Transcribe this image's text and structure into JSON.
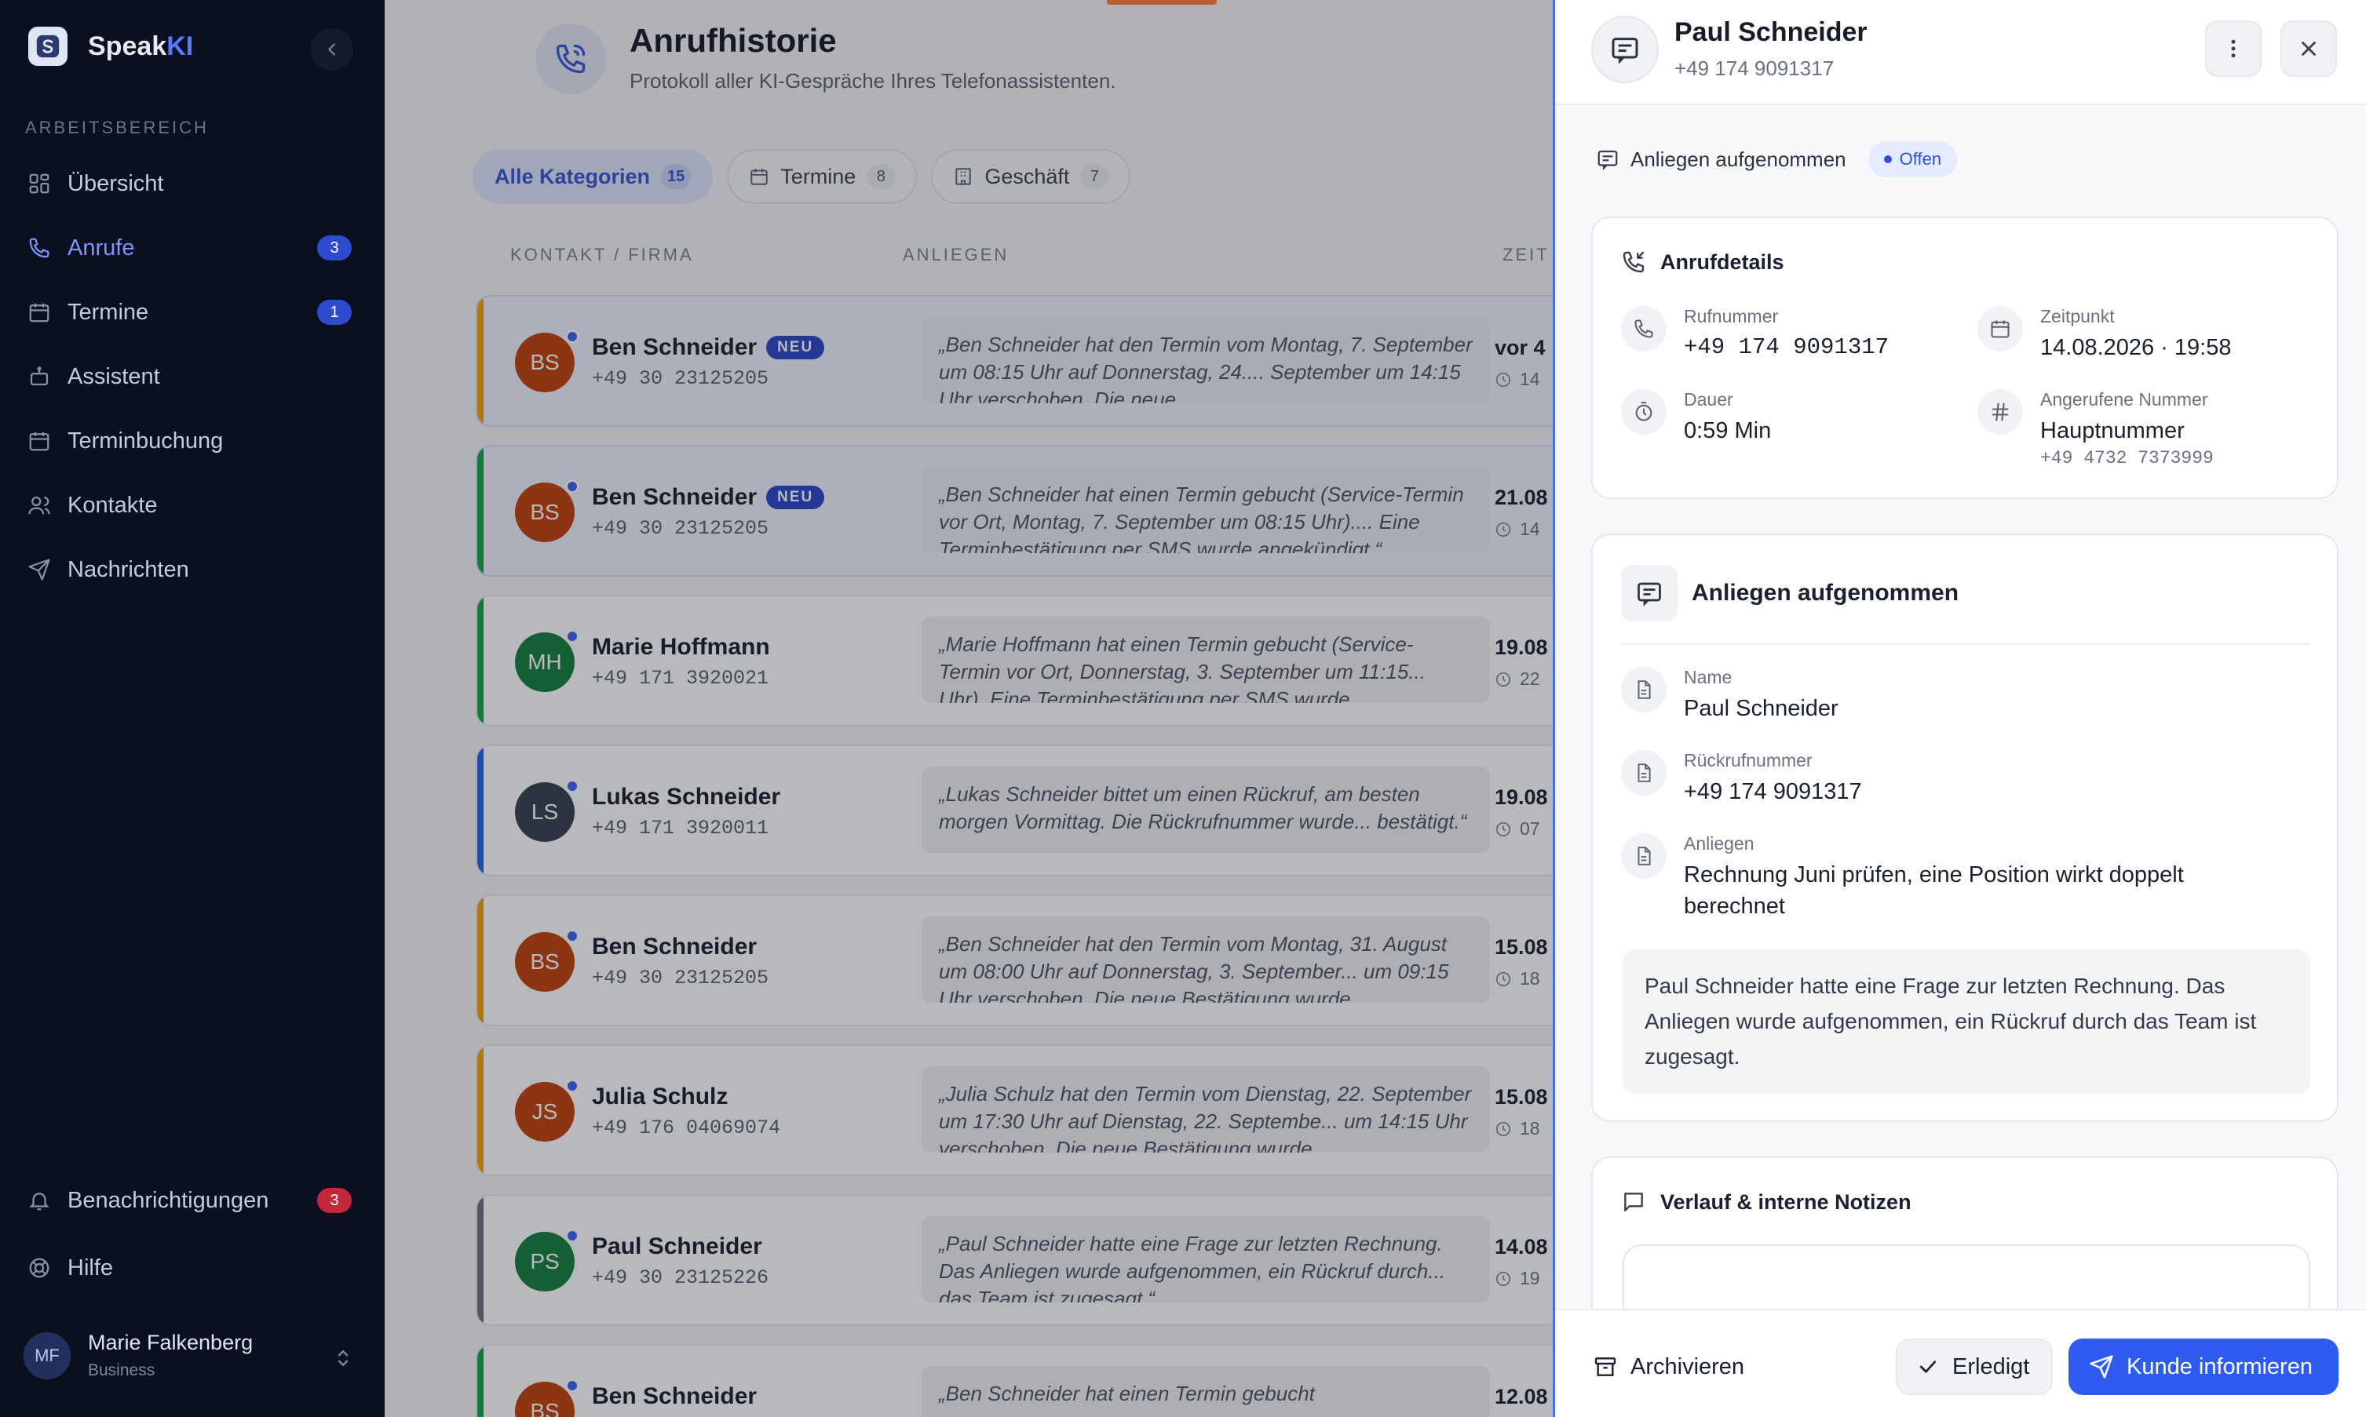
{
  "app": {
    "brand_prefix": "Speak",
    "brand_suffix": "KI"
  },
  "sidebar": {
    "section_label": "ARBEITSBEREICH",
    "items": [
      {
        "label": "Übersicht",
        "icon": "grid-icon",
        "badge": ""
      },
      {
        "label": "Anrufe",
        "icon": "phone-icon",
        "badge": "3",
        "active": true
      },
      {
        "label": "Termine",
        "icon": "calendar-icon",
        "badge": "1"
      },
      {
        "label": "Assistent",
        "icon": "bot-icon",
        "badge": ""
      },
      {
        "label": "Terminbuchung",
        "icon": "calendar-icon",
        "badge": ""
      },
      {
        "label": "Kontakte",
        "icon": "users-icon",
        "badge": ""
      },
      {
        "label": "Nachrichten",
        "icon": "send-icon",
        "badge": ""
      }
    ],
    "notifications": {
      "label": "Benachrichtigungen",
      "badge": "3"
    },
    "help": {
      "label": "Hilfe"
    },
    "user": {
      "initials": "MF",
      "name": "Marie Falkenberg",
      "plan": "Business"
    }
  },
  "page": {
    "title": "Anrufhistorie",
    "subtitle": "Protokoll aller KI-Gespräche Ihres Telefonassistenten."
  },
  "filters": [
    {
      "label": "Alle Kategorien",
      "count": "15",
      "active": true
    },
    {
      "label": "Termine",
      "count": "8"
    },
    {
      "label": "Geschäft",
      "count": "7"
    }
  ],
  "table": {
    "columns": [
      "KONTAKT / FIRMA",
      "ANLIEGEN",
      "ZEIT"
    ],
    "rows": [
      {
        "initials": "BS",
        "name": "Ben Schneider",
        "neu": "NEU",
        "phone": "+49 30 23125205",
        "message": "„Ben Schneider hat den Termin vom Montag, 7. September um 08:15 Uhr auf Donnerstag, 24.... September um 14:15 Uhr verschoben. Die neue",
        "time": "vor 4",
        "time2": "14",
        "avatar_color": "#c2410c",
        "bar_color": "#f59e0b",
        "highlight": true
      },
      {
        "initials": "BS",
        "name": "Ben Schneider",
        "neu": "NEU",
        "phone": "+49 30 23125205",
        "message": "„Ben Schneider hat einen Termin gebucht (Service-Termin vor Ort, Montag, 7. September um 08:15 Uhr).... Eine Terminbestätigung per SMS wurde angekündigt.“",
        "time": "21.08",
        "time2": "14",
        "avatar_color": "#c2410c",
        "bar_color": "#16a34a",
        "highlight": true
      },
      {
        "initials": "MH",
        "name": "Marie Hoffmann",
        "neu": "",
        "phone": "+49 171 3920021",
        "message": "„Marie Hoffmann hat einen Termin gebucht (Service-Termin vor Ort, Donnerstag, 3. September um 11:15... Uhr). Eine Terminbestätigung per SMS wurde",
        "time": "19.08",
        "time2": "22",
        "avatar_color": "#15803d",
        "bar_color": "#16a34a",
        "highlight": false
      },
      {
        "initials": "LS",
        "name": "Lukas Schneider",
        "neu": "",
        "phone": "+49 171 3920011",
        "message": "„Lukas Schneider bittet um einen Rückruf, am besten morgen Vormittag. Die Rückrufnummer wurde... bestätigt.“",
        "time": "19.08",
        "time2": "07",
        "avatar_color": "#374151",
        "bar_color": "#2563eb",
        "highlight": false
      },
      {
        "initials": "BS",
        "name": "Ben Schneider",
        "neu": "",
        "phone": "+49 30 23125205",
        "message": "„Ben Schneider hat den Termin vom Montag, 31. August um 08:00 Uhr auf Donnerstag, 3. September... um 09:15 Uhr verschoben. Die neue Bestätigung wurde",
        "time": "15.08",
        "time2": "18",
        "avatar_color": "#c2410c",
        "bar_color": "#f59e0b",
        "highlight": false
      },
      {
        "initials": "JS",
        "name": "Julia Schulz",
        "neu": "",
        "phone": "+49 176 04069074",
        "message": "„Julia Schulz hat den Termin vom Dienstag, 22. September um 17:30 Uhr auf Dienstag, 22. Septembe... um 14:15 Uhr verschoben. Die neue Bestätigung wurde",
        "time": "15.08",
        "time2": "18",
        "avatar_color": "#c2410c",
        "bar_color": "#f59e0b",
        "highlight": false
      },
      {
        "initials": "PS",
        "name": "Paul Schneider",
        "neu": "",
        "phone": "+49 30 23125226",
        "message": "„Paul Schneider hatte eine Frage zur letzten Rechnung. Das Anliegen wurde aufgenommen, ein Rückruf durch... das Team ist zugesagt.“",
        "time": "14.08",
        "time2": "19",
        "avatar_color": "#15803d",
        "bar_color": "#6b7280",
        "highlight": false
      },
      {
        "initials": "BS",
        "name": "Ben Schneider",
        "neu": "",
        "phone": "",
        "message": "„Ben Schneider hat einen Termin gebucht",
        "time": "12.08",
        "time2": "",
        "avatar_color": "#c2410c",
        "bar_color": "#16a34a",
        "highlight": false
      }
    ]
  },
  "drawer": {
    "name": "Paul Schneider",
    "phone": "+49 174 9091317",
    "tag": "Anliegen aufgenommen",
    "status": "Offen",
    "details": {
      "title": "Anrufdetails",
      "rufnummer_label": "Rufnummer",
      "rufnummer": "+49 174 9091317",
      "zeitpunkt_label": "Zeitpunkt",
      "zeitpunkt": "14.08.2026 · 19:58",
      "dauer_label": "Dauer",
      "dauer": "0:59 Min",
      "angerufen_label": "Angerufene Nummer",
      "angerufen": "Hauptnummer",
      "angerufen_sub": "+49 4732 7373999"
    },
    "anliegen": {
      "title": "Anliegen aufgenommen",
      "name_label": "Name",
      "name": "Paul Schneider",
      "rueckruf_label": "Rückrufnummer",
      "rueckruf": "+49 174 9091317",
      "anliegen_label": "Anliegen",
      "anliegen": "Rechnung Juni prüfen, eine Position wirkt doppelt berechnet",
      "summary": "Paul Schneider hatte eine Frage zur letzten Rechnung. Das Anliegen wurde aufgenommen, ein Rückruf durch das Team ist zugesagt."
    },
    "notes": {
      "title": "Verlauf & interne Notizen"
    },
    "footer": {
      "archive": "Archivieren",
      "done": "Erledigt",
      "inform": "Kunde informieren"
    }
  },
  "colors": {
    "accent": "#2f5cf0",
    "sidebar_bg": "#0b1020",
    "badge_red": "#c2273a"
  }
}
